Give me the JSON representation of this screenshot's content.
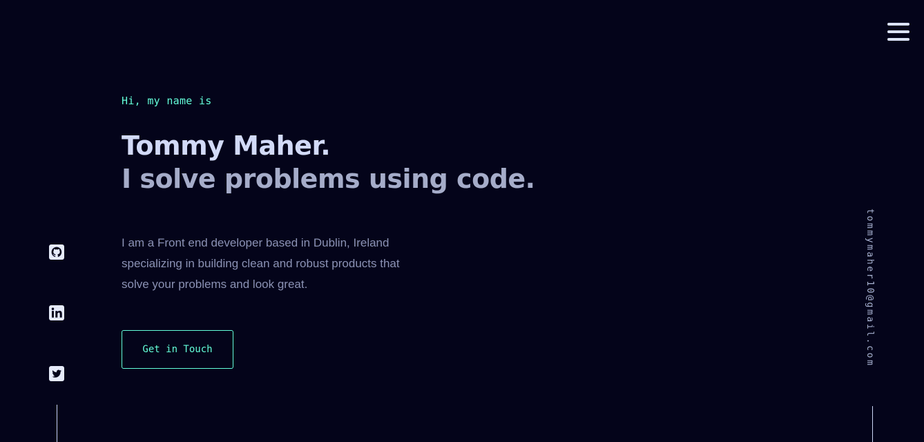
{
  "nav": {
    "menu_icon": "hamburger-menu-icon"
  },
  "hero": {
    "greeting": "Hi, my name is",
    "name": "Tommy Maher.",
    "tagline": "I solve problems using code.",
    "bio": "I am a Front end developer based in Dublin, Ireland specializing in building clean and robust products that solve your problems and look great.",
    "cta_label": "Get in Touch"
  },
  "social": [
    {
      "icon": "github-icon"
    },
    {
      "icon": "linkedin-icon"
    },
    {
      "icon": "twitter-icon"
    }
  ],
  "email": "tommymaher10@gmail.com",
  "colors": {
    "background": "#04041a",
    "accent": "#64ffda",
    "heading": "#d2daf7",
    "subheading": "#a5acc9",
    "body_text": "#8b92b4"
  }
}
